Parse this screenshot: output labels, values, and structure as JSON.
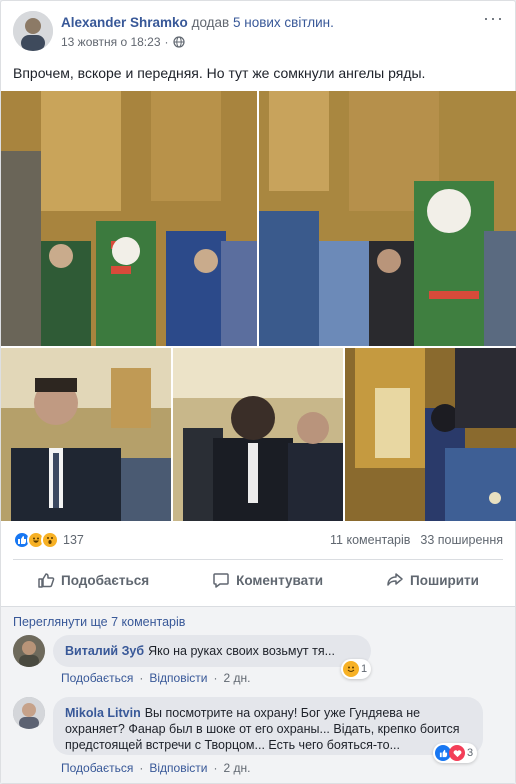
{
  "post": {
    "author": "Alexander Shramko",
    "action": "додав",
    "action_link": "5 нових світлин.",
    "timestamp": "13 жовтня о 18:23",
    "privacy_icon": "globe-icon",
    "menu_icon": "more-icon",
    "text": "Впрочем, вскоре и передняя. Но тут же сомкнули ангелы ряды."
  },
  "photos": [
    {
      "name": "photo-1",
      "icon": "image"
    },
    {
      "name": "photo-2",
      "icon": "image"
    },
    {
      "name": "photo-3",
      "icon": "image"
    },
    {
      "name": "photo-4",
      "icon": "image"
    },
    {
      "name": "photo-5",
      "icon": "image"
    }
  ],
  "stats": {
    "reaction_count": "137",
    "comments": "11 коментарів",
    "shares": "33 поширення",
    "reaction_icons": [
      "like-icon",
      "haha-icon",
      "wow-icon"
    ]
  },
  "actions": {
    "like": "Подобається",
    "comment": "Коментувати",
    "share": "Поширити"
  },
  "comments_section": {
    "more": "Переглянути ще 7 коментарів",
    "items": [
      {
        "name": "Виталий Зуб",
        "text": "Яко на руках своих возьмут тя...",
        "like": "Подобається",
        "reply": "Відповісти",
        "time": "2 дн.",
        "reaction_count": "1",
        "reaction_icons": [
          "smile-icon"
        ]
      },
      {
        "name": "Mikola Litvin",
        "text_line1": "Вы посмотрите на охрану! Бог уже Гундяева не",
        "text_line2": "охраняет? Фанар был в шоке от его охраны... Відать, крепко боится",
        "text_line3": "предстоящей встречи с Творцом... Есть чего бояться-то...",
        "like": "Подобається",
        "reply": "Відповісти",
        "time": "2 дн.",
        "reaction_count": "3",
        "reaction_icons": [
          "like-icon",
          "love-icon"
        ]
      }
    ]
  },
  "colors": {
    "link": "#385898",
    "secondary_text": "#606770",
    "like_blue": "#1877f2",
    "love_red": "#f33e58",
    "haha_yellow": "#f7b125"
  }
}
